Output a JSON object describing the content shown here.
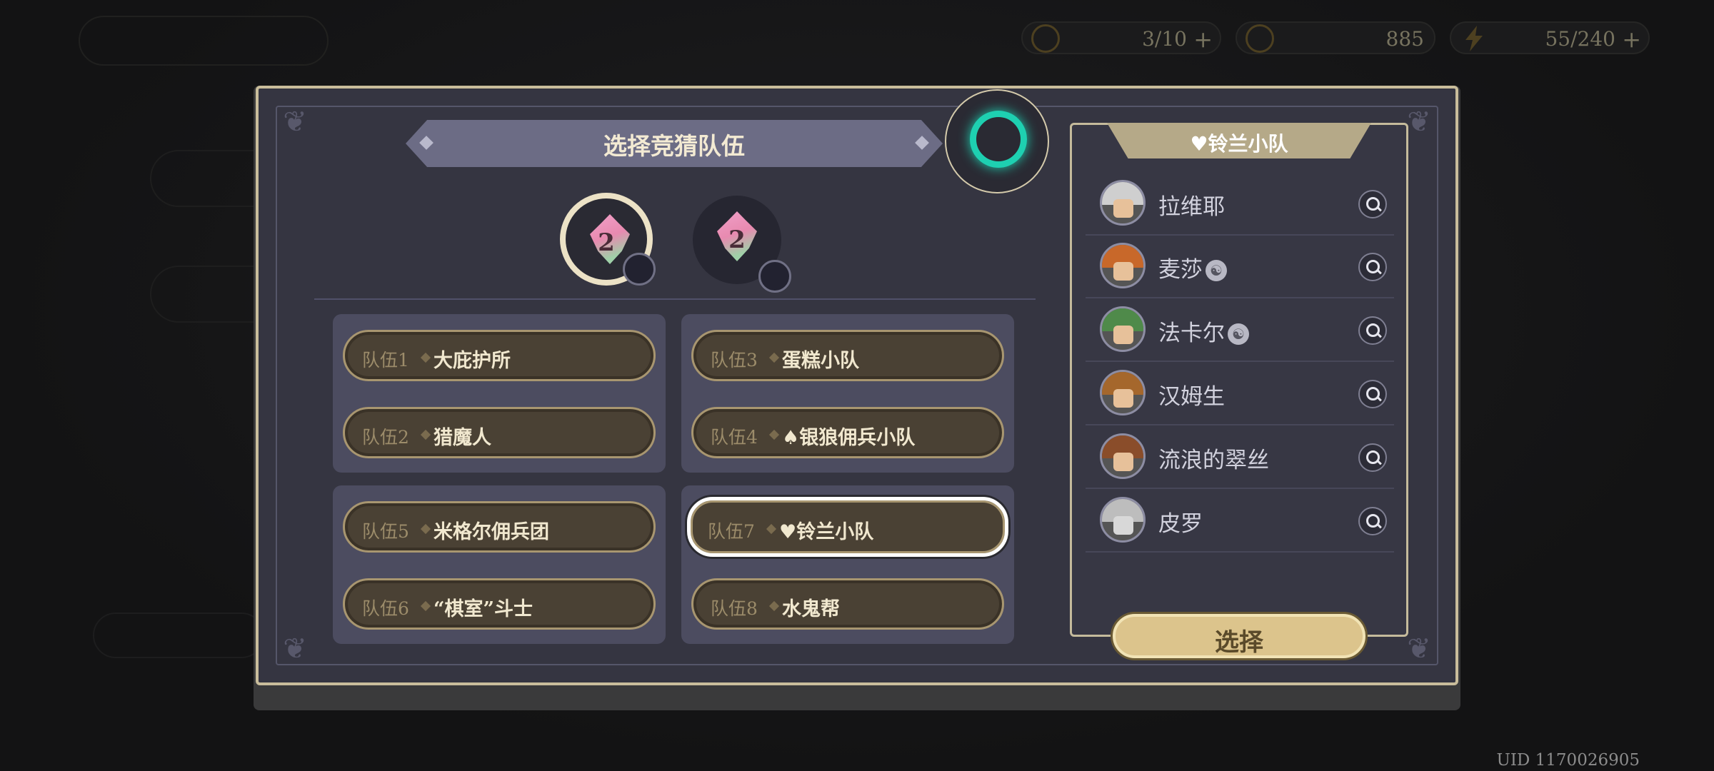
{
  "hud": {
    "resources": [
      {
        "icon": "card-icon",
        "value": "3/10",
        "plus": "+"
      },
      {
        "icon": "coin-icon",
        "value": "885",
        "plus": ""
      },
      {
        "icon": "lightning-icon",
        "value": "55/240",
        "plus": "+"
      }
    ],
    "uid": "UID 1170026905"
  },
  "dialog": {
    "title": "选择竞猜队伍",
    "group_tokens": [
      {
        "number": "2",
        "selected": true
      },
      {
        "number": "2",
        "selected": false
      }
    ],
    "teams": [
      {
        "tag": "队伍1",
        "name": "大庇护所"
      },
      {
        "tag": "队伍2",
        "name": "猎魔人"
      },
      {
        "tag": "队伍3",
        "name": "蛋糕小队"
      },
      {
        "tag": "队伍4",
        "name": "♠银狼佣兵小队"
      },
      {
        "tag": "队伍5",
        "name": "米格尔佣兵团"
      },
      {
        "tag": "队伍6",
        "name": "“棋室”斗士"
      },
      {
        "tag": "队伍7",
        "name": "♥铃兰小队"
      },
      {
        "tag": "队伍8",
        "name": "水鬼帮"
      }
    ],
    "selected_team": "队伍7"
  },
  "roster": {
    "team_name": "♥铃兰小队",
    "members": [
      {
        "name": "拉维耶",
        "mark": false
      },
      {
        "name": "麦莎",
        "mark": true
      },
      {
        "name": "法卡尔",
        "mark": true
      },
      {
        "name": "汉姆生",
        "mark": false
      },
      {
        "name": "流浪的翠丝",
        "mark": false
      },
      {
        "name": "皮罗",
        "mark": false
      }
    ],
    "select_label": "选择"
  },
  "colors": {
    "accent_gold": "#dcc48c",
    "portal_teal": "#1ed0b1",
    "panel_bg": "#353541"
  }
}
